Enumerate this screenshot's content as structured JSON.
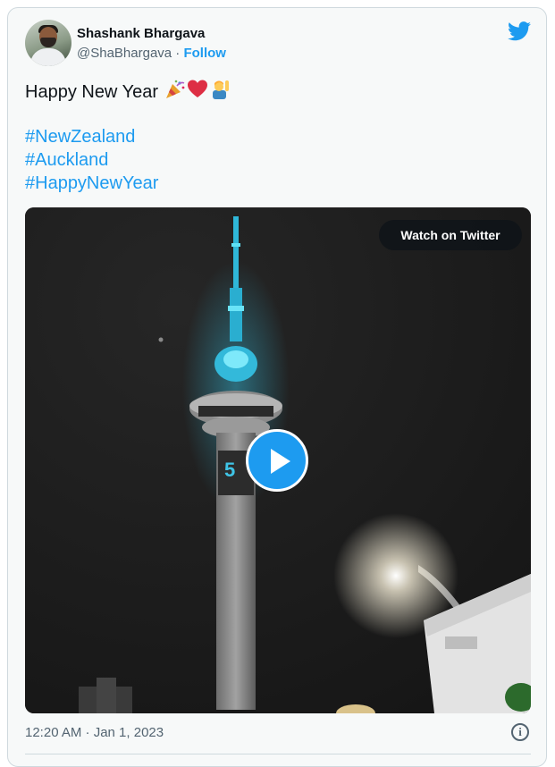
{
  "author": {
    "name": "Shashank Bhargava",
    "handle": "@ShaBhargava",
    "separator": " · ",
    "follow_label": "Follow",
    "avatar_icon": "user-avatar"
  },
  "brand": {
    "icon": "twitter-bird-icon",
    "color": "#1d9bf0"
  },
  "tweet": {
    "text": "Happy New Year",
    "emojis": [
      "party-popper-icon",
      "red-heart-icon",
      "person-raising-hand-icon"
    ],
    "hashtags": [
      "#NewZealand",
      "#Auckland",
      "#HappyNewYear"
    ]
  },
  "media": {
    "type": "video",
    "watch_label": "Watch on Twitter",
    "overlay_text": "5",
    "play_icon": "play-icon"
  },
  "footer": {
    "timestamp": "12:20 AM · Jan 1, 2023",
    "info_icon": "info-icon"
  },
  "colors": {
    "accent": "#1d9bf0",
    "text": "#0f1419",
    "muted": "#536471",
    "card_bg": "#f7f9f9",
    "border": "#cfd9de"
  }
}
